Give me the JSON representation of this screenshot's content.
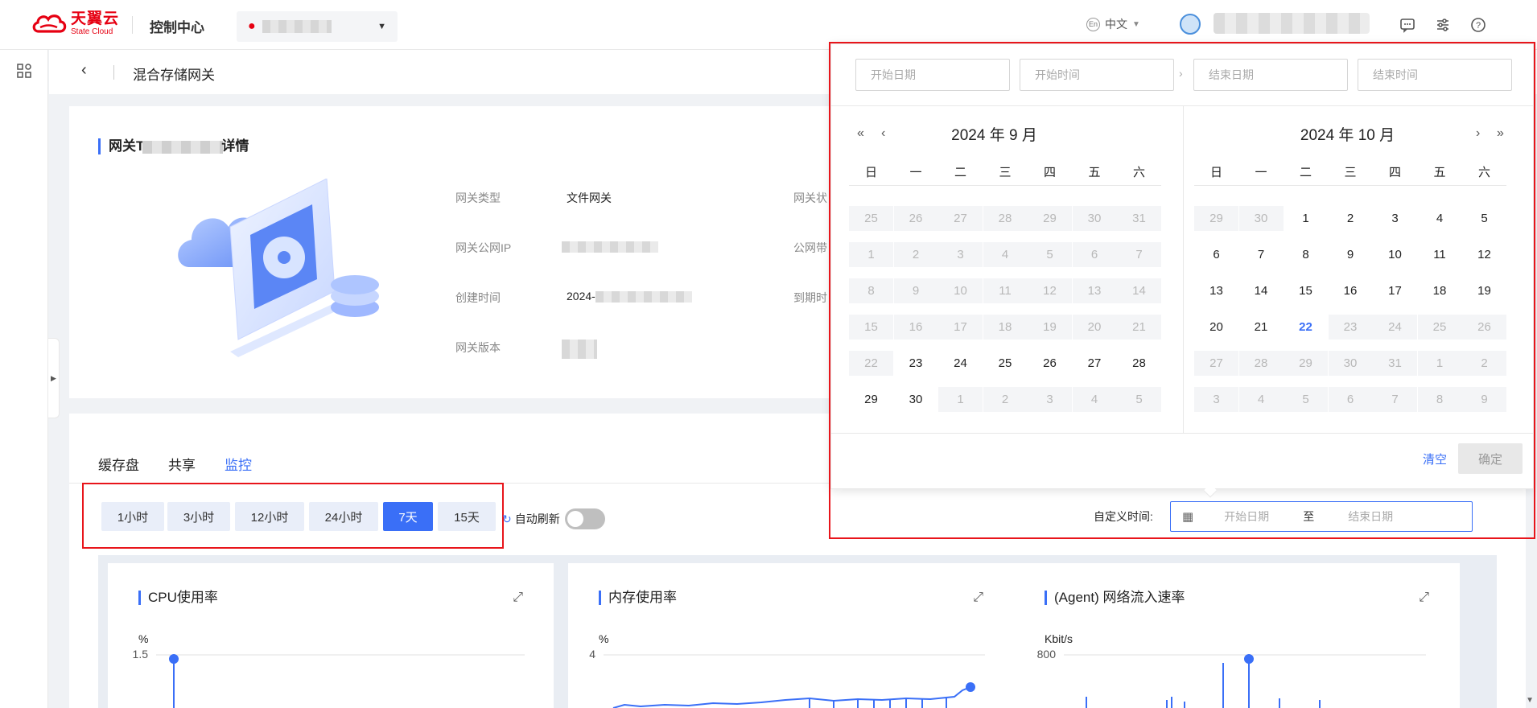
{
  "header": {
    "brand_cn": "天翼云",
    "brand_en": "State Cloud",
    "console_title": "控制中心",
    "lang_badge": "En",
    "lang_label": "中文",
    "icons": [
      "message-icon",
      "settings-sliders-icon",
      "help-icon"
    ]
  },
  "breadcrumb": {
    "title": "混合存储网关"
  },
  "info": {
    "title_prefix": "网关T",
    "title_suffix": "详情",
    "fields": [
      {
        "key": "网关类型",
        "value": "文件网关"
      },
      {
        "key": "网关公网IP",
        "value": ""
      },
      {
        "key": "创建时间",
        "value": "2024-"
      },
      {
        "key": "网关版本",
        "value": ""
      }
    ],
    "right_keys": [
      "网关状",
      "公网带",
      "到期时"
    ]
  },
  "monitor": {
    "tabs": [
      {
        "label": "缓存盘",
        "active": false
      },
      {
        "label": "共享",
        "active": false
      },
      {
        "label": "监控",
        "active": true
      }
    ],
    "ranges": [
      {
        "label": "1小时",
        "active": false
      },
      {
        "label": "3小时",
        "active": false
      },
      {
        "label": "12小时",
        "active": false
      },
      {
        "label": "24小时",
        "active": false
      },
      {
        "label": "7天",
        "active": true
      },
      {
        "label": "15天",
        "active": false
      }
    ],
    "auto_refresh_label": "自动刷新",
    "auto_refresh_on": false,
    "custom_time_label": "自定义时间:",
    "custom_start_placeholder": "开始日期",
    "custom_to": "至",
    "custom_end_placeholder": "结束日期"
  },
  "charts": [
    {
      "title": "CPU使用率",
      "unit": "%",
      "top_tick": "1.5"
    },
    {
      "title": "内存使用率",
      "unit": "%",
      "top_tick": "4"
    },
    {
      "title": "(Agent) 网络流入速率",
      "unit": "Kbit/s",
      "top_tick": "800"
    }
  ],
  "picker": {
    "start_date_placeholder": "开始日期",
    "start_time_placeholder": "开始时间",
    "end_date_placeholder": "结束日期",
    "end_time_placeholder": "结束时间",
    "weekdays": [
      "日",
      "一",
      "二",
      "三",
      "四",
      "五",
      "六"
    ],
    "left_month": "2024 年 9 月",
    "right_month": "2024 年 10 月",
    "left_days": [
      [
        "25",
        "26",
        "27",
        "28",
        "29",
        "30",
        "31"
      ],
      [
        "1",
        "2",
        "3",
        "4",
        "5",
        "6",
        "7"
      ],
      [
        "8",
        "9",
        "10",
        "11",
        "12",
        "13",
        "14"
      ],
      [
        "15",
        "16",
        "17",
        "18",
        "19",
        "20",
        "21"
      ],
      [
        "22",
        "23",
        "24",
        "25",
        "26",
        "27",
        "28"
      ],
      [
        "29",
        "30",
        "1",
        "2",
        "3",
        "4",
        "5"
      ]
    ],
    "right_days": [
      [
        "29",
        "30",
        "1",
        "2",
        "3",
        "4",
        "5"
      ],
      [
        "6",
        "7",
        "8",
        "9",
        "10",
        "11",
        "12"
      ],
      [
        "13",
        "14",
        "15",
        "16",
        "17",
        "18",
        "19"
      ],
      [
        "20",
        "21",
        "22",
        "23",
        "24",
        "25",
        "26"
      ],
      [
        "27",
        "28",
        "29",
        "30",
        "31",
        "1",
        "2"
      ],
      [
        "3",
        "4",
        "5",
        "6",
        "7",
        "8",
        "9"
      ]
    ],
    "today": "2024-10-22",
    "clear_label": "清空",
    "confirm_label": "确定"
  },
  "colors": {
    "accent": "#3a6ff7",
    "brand_red": "#e60012",
    "highlight_red": "#e8151b"
  }
}
